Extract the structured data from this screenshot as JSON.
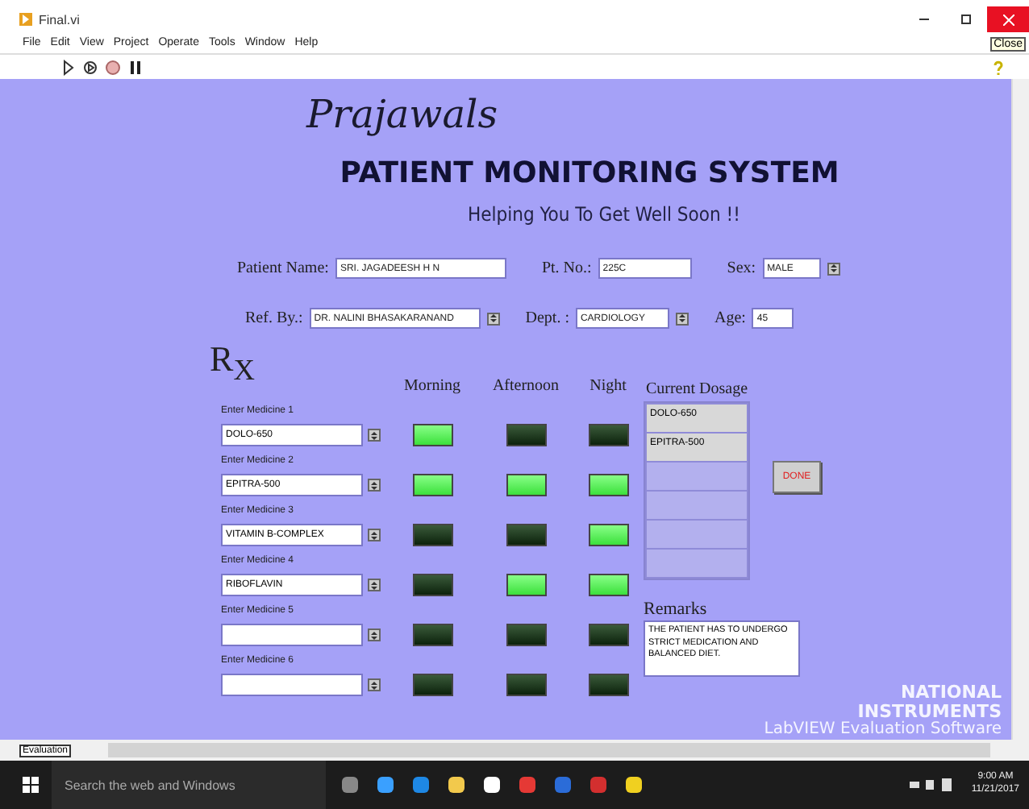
{
  "window": {
    "title": "Final.vi",
    "tooltip": "Close"
  },
  "menu": [
    "File",
    "Edit",
    "View",
    "Project",
    "Operate",
    "Tools",
    "Window",
    "Help"
  ],
  "header": {
    "logo": "Prajawals",
    "title": "PATIENT MONITORING SYSTEM",
    "subtitle": "Helping You To Get Well Soon !!"
  },
  "patient": [
    {
      "label": "Patient Name:",
      "value": "SRI. JAGADEESH H N",
      "kind": "text"
    },
    {
      "label": "Pt. No.:",
      "value": "225C",
      "kind": "text"
    },
    {
      "label": "Sex:",
      "value": "MALE",
      "kind": "ring"
    }
  ],
  "referral": [
    {
      "label": "Ref. By.:",
      "value": "DR. NALINI BHASAKARANAND",
      "kind": "ring"
    },
    {
      "label": "Dept. :",
      "value": "CARDIOLOGY",
      "kind": "ring"
    },
    {
      "label": "Age:",
      "value": "45",
      "kind": "text"
    }
  ],
  "rx": "R$_{X}$",
  "dose_headers": [
    "Morning",
    "Afternoon",
    "Night"
  ],
  "medicines": [
    {
      "label": "Enter Medicine 1",
      "value": "DOLO-650",
      "morning": true,
      "afternoon": false,
      "night": false
    },
    {
      "label": "Enter Medicine 2",
      "value": "EPITRA-500",
      "morning": true,
      "afternoon": true,
      "night": true
    },
    {
      "label": "Enter Medicine 3",
      "value": "VITAMIN B-COMPLEX",
      "morning": false,
      "afternoon": false,
      "night": true
    },
    {
      "label": "Enter Medicine 4",
      "value": "RIBOFLAVIN",
      "morning": false,
      "afternoon": true,
      "night": true
    },
    {
      "label": "Enter Medicine 5",
      "morning": false,
      "afternoon": false,
      "night": false
    },
    {
      "label": "Enter Medicine 6",
      "morning": false,
      "afternoon": false,
      "night": false
    }
  ],
  "dosage": {
    "label": "Current Dosage",
    "entries": [
      "DOLO-650",
      "EPITRA-500"
    ]
  },
  "done_button": "DONE",
  "remarks": {
    "label": "Remarks",
    "value": "THE PATIENT HAS TO UNDERGO STRICT MEDICATION AND BALANCED DIET."
  },
  "branding": {
    "line_1": "NATIONAL",
    "line_2": "INSTRUMENTS",
    "line_3": "LabVIEW Evaluation Software"
  },
  "status_bar": {
    "tag": "Evaluation"
  },
  "taskbar": {
    "search_placeholder": "Search the web and Windows",
    "time": "9:00 AM",
    "date": "11/21/2017"
  }
}
